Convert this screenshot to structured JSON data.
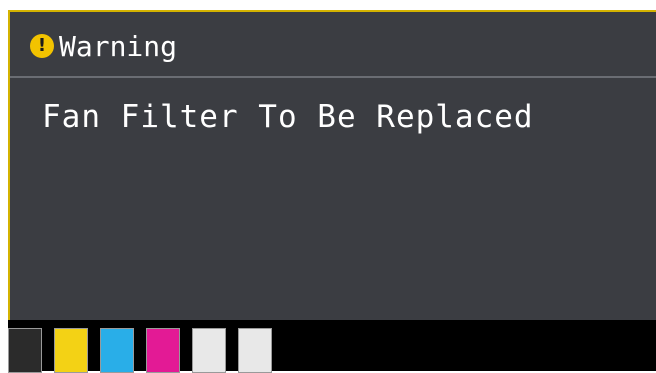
{
  "header": {
    "icon": "warning-icon",
    "icon_color": "#f2c300",
    "title": "Warning"
  },
  "message": {
    "text": "Fan Filter To Be Replaced"
  },
  "ink_slots": [
    {
      "name": "black",
      "color": "#2b2b2b"
    },
    {
      "name": "yellow",
      "color": "#f3d215"
    },
    {
      "name": "cyan",
      "color": "#29aee8"
    },
    {
      "name": "magenta",
      "color": "#e31a95"
    },
    {
      "name": "white-1",
      "color": "#e8e8e8"
    },
    {
      "name": "white-2",
      "color": "#e8e8e8"
    }
  ],
  "colors": {
    "lcd_background": "#3b3d42",
    "frame_accent": "#d4b300",
    "ink_bar_background": "#000000"
  }
}
